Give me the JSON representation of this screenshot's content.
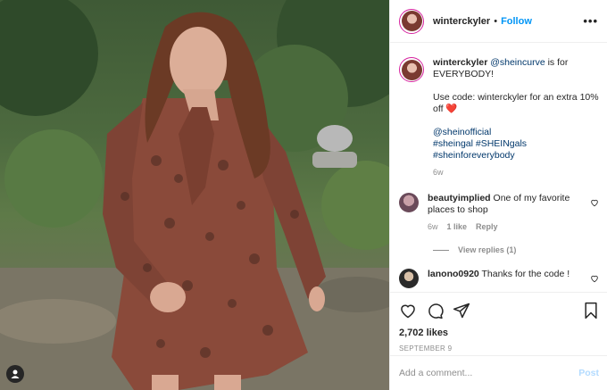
{
  "header": {
    "username": "winterckyler",
    "dot": "•",
    "follow_label": "Follow",
    "more_icon": "ellipsis-icon"
  },
  "caption": {
    "username": "winterckyler",
    "mention": "@sheincurve",
    "text_after_mention": " is for EVERYBODY!",
    "line2": "Use code: winterckyler for an extra 10% off ",
    "emoji": "❤️",
    "tag_line1": "@sheinofficial",
    "tag_line2": "#sheingal #SHEINgals",
    "tag_line3": "#sheinforeverybody",
    "time": "6w"
  },
  "comments": [
    {
      "username": "beautyimplied",
      "text": " One of my favorite places to shop",
      "time": "6w",
      "likes": "1 like",
      "reply_label": "Reply",
      "view_replies": "View replies (1)"
    },
    {
      "username": "lanono0920",
      "text": " Thanks for the code !"
    }
  ],
  "actions": {
    "likes": "2,702 likes",
    "date": "SEPTEMBER 9"
  },
  "add_comment": {
    "placeholder": "Add a comment...",
    "post_label": "Post"
  },
  "colors": {
    "link_blue": "#0095f6",
    "post_disabled": "#b3dbff",
    "muted": "#8e8e8e"
  }
}
